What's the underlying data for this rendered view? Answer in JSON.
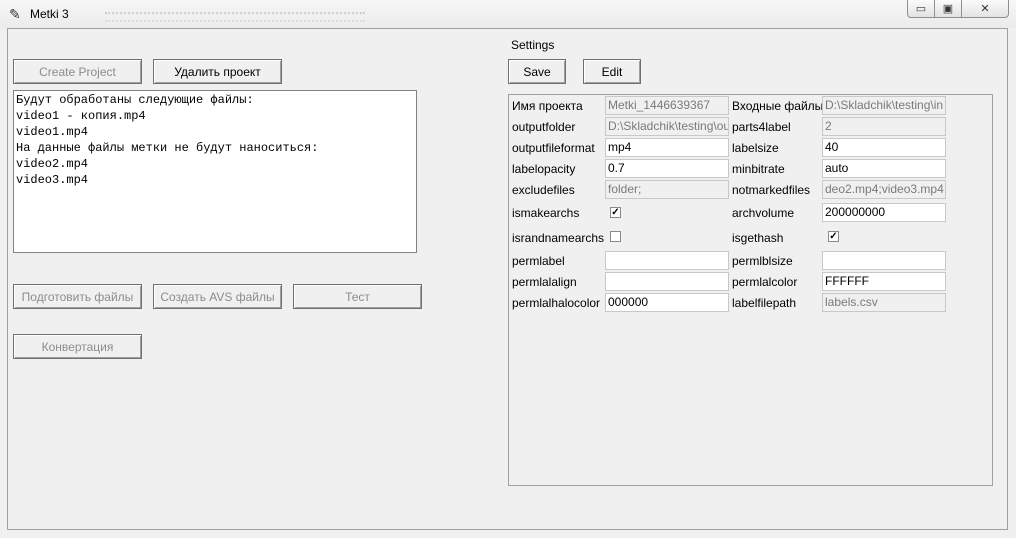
{
  "window": {
    "title": "Metki 3",
    "controls": {
      "minimize": "▭",
      "maximize": "▣",
      "close": "✕"
    },
    "app_icon": "feather-icon"
  },
  "left": {
    "create_project": "Create Project",
    "delete_project": "Удалить проект",
    "log_text": "Будут обработаны следующие файлы:\nvideo1 - копия.mp4\nvideo1.mp4\nНа данные файлы метки не будут наноситься:\nvideo2.mp4\nvideo3.mp4",
    "prepare_files": "Подготовить файлы",
    "create_avs": "Создать AVS файлы",
    "test": "Тест",
    "convert": "Конвертация"
  },
  "settings": {
    "title": "Settings",
    "save": "Save",
    "edit": "Edit",
    "fields": {
      "project_name": {
        "label": "Имя проекта",
        "value": "Metki_1446639367"
      },
      "input_files": {
        "label": "Входные файлы",
        "value": "D:\\Skladchik\\testing\\in"
      },
      "outputfolder": {
        "label": "outputfolder",
        "value": "D:\\Skladchik\\testing\\ou"
      },
      "parts4label": {
        "label": "parts4label",
        "value": "2"
      },
      "outputfileformat": {
        "label": "outputfileformat",
        "value": "mp4"
      },
      "labelsize": {
        "label": "labelsize",
        "value": "40"
      },
      "labelopacity": {
        "label": "labelopacity",
        "value": "0.7"
      },
      "minbitrate": {
        "label": "minbitrate",
        "value": "auto"
      },
      "excludefiles": {
        "label": "excludefiles",
        "value": "folder;"
      },
      "notmarkedfiles": {
        "label": "notmarkedfiles",
        "value": "deo2.mp4;video3.mp4"
      },
      "ismakearchs": {
        "label": "ismakearchs",
        "checked": true
      },
      "archvolume": {
        "label": "archvolume",
        "value": "200000000"
      },
      "israndnamearchs": {
        "label": "israndnamearchs",
        "checked": false
      },
      "isgethash": {
        "label": "isgethash",
        "checked": true
      },
      "permlabel": {
        "label": "permlabel",
        "value": ""
      },
      "permlblsize": {
        "label": "permlblsize",
        "value": ""
      },
      "permlalalign": {
        "label": "permlalalign",
        "value": ""
      },
      "permlalcolor": {
        "label": "permlalcolor",
        "value": "FFFFFF"
      },
      "permlalhalocolor": {
        "label": "permlalhalocolor",
        "value": "000000"
      },
      "labelfilepath": {
        "label": "labelfilepath",
        "value": "labels.csv"
      }
    }
  }
}
